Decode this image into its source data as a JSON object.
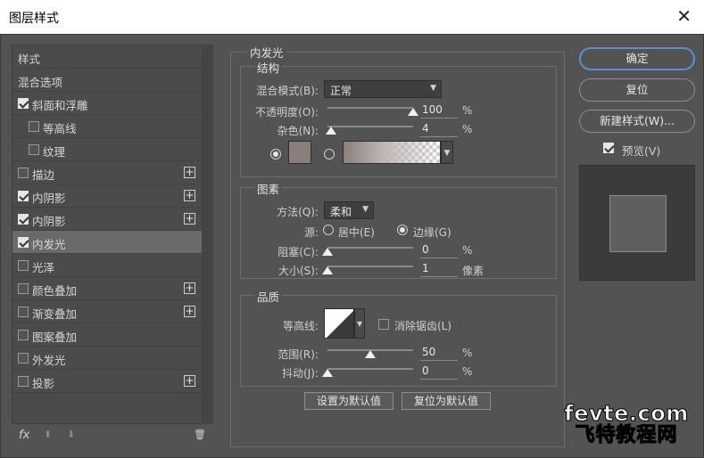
{
  "window": {
    "title": "图层样式",
    "close": "✕"
  },
  "sidebar": {
    "items": [
      {
        "label": "样式",
        "checkbox": false,
        "checked": false,
        "plus": false
      },
      {
        "label": "混合选项",
        "checkbox": false,
        "checked": false,
        "plus": false
      },
      {
        "label": "斜面和浮雕",
        "checkbox": true,
        "checked": true,
        "plus": false
      },
      {
        "label": "等高线",
        "checkbox": true,
        "checked": false,
        "plus": false,
        "indent": true
      },
      {
        "label": "纹理",
        "checkbox": true,
        "checked": false,
        "plus": false,
        "indent": true
      },
      {
        "label": "描边",
        "checkbox": true,
        "checked": false,
        "plus": true
      },
      {
        "label": "内阴影",
        "checkbox": true,
        "checked": true,
        "plus": true
      },
      {
        "label": "内阴影",
        "checkbox": true,
        "checked": true,
        "plus": true
      },
      {
        "label": "内发光",
        "checkbox": true,
        "checked": true,
        "plus": false,
        "selected": true
      },
      {
        "label": "光泽",
        "checkbox": true,
        "checked": false,
        "plus": false
      },
      {
        "label": "颜色叠加",
        "checkbox": true,
        "checked": false,
        "plus": true
      },
      {
        "label": "渐变叠加",
        "checkbox": true,
        "checked": false,
        "plus": true
      },
      {
        "label": "图案叠加",
        "checkbox": true,
        "checked": false,
        "plus": false
      },
      {
        "label": "外发光",
        "checkbox": true,
        "checked": false,
        "plus": false
      },
      {
        "label": "投影",
        "checkbox": true,
        "checked": false,
        "plus": true
      }
    ],
    "bottom": {
      "fx": "fx",
      "up": "⬆",
      "down": "⬇",
      "trash": "🗑"
    }
  },
  "panel": {
    "title": "内发光",
    "structure": {
      "title": "结构",
      "blend_mode_label": "混合模式(B):",
      "blend_mode_value": "正常",
      "opacity_label": "不透明度(O):",
      "opacity_value": "100",
      "opacity_percent": 100,
      "noise_label": "杂色(N):",
      "noise_value": "4",
      "noise_percent": 4,
      "unit": "%"
    },
    "elements": {
      "title": "图素",
      "method_label": "方法(Q):",
      "method_value": "柔和",
      "source_label": "源:",
      "source_center": "居中(E)",
      "source_edge": "边缘(G)",
      "choke_label": "阻塞(C):",
      "choke_value": "0",
      "choke_percent": 0,
      "size_label": "大小(S):",
      "size_value": "1",
      "size_percent": 0,
      "size_unit": "像素",
      "unit": "%"
    },
    "quality": {
      "title": "品质",
      "contour_label": "等高线:",
      "antialias_label": "消除锯齿(L)",
      "range_label": "范围(R):",
      "range_value": "50",
      "range_percent": 50,
      "jitter_label": "抖动(J):",
      "jitter_value": "0",
      "jitter_percent": 0,
      "unit": "%"
    },
    "make_default": "设置为默认值",
    "reset_default": "复位为默认值"
  },
  "buttons": {
    "ok": "确定",
    "reset": "复位",
    "new_style": "新建样式(W)...",
    "preview_label": "预览(V)",
    "preview_checked": true
  },
  "watermark": {
    "line1": "fevte.com",
    "line2": "飞特教程网"
  },
  "colors": {
    "accent": "#5b8fd1",
    "background": "#535353",
    "swatch": "#8a7f7d"
  }
}
